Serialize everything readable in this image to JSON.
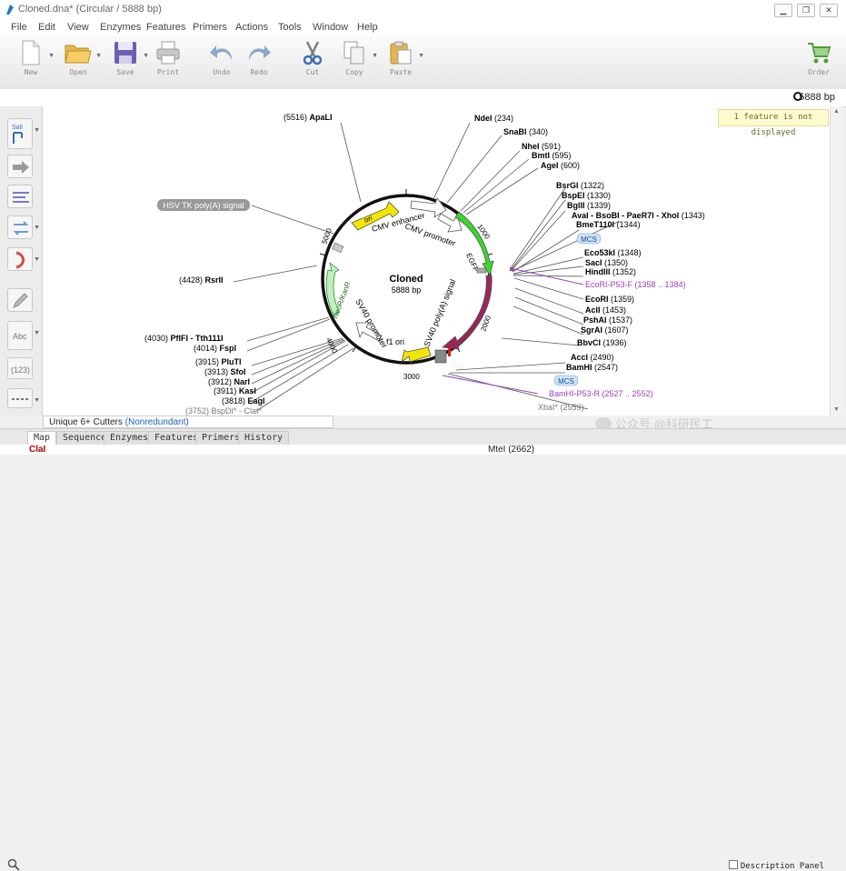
{
  "window": {
    "title": "Cloned.dna* (Circular / 5888 bp)"
  },
  "menu": [
    "File",
    "Edit",
    "View",
    "Enzymes",
    "Features",
    "Primers",
    "Actions",
    "Tools",
    "Window",
    "Help"
  ],
  "toolbar": [
    {
      "name": "new",
      "label": "New"
    },
    {
      "name": "open",
      "label": "Open"
    },
    {
      "name": "save",
      "label": "Save"
    },
    {
      "name": "print",
      "label": "Print"
    },
    {
      "name": "undo",
      "label": "Undo"
    },
    {
      "name": "redo",
      "label": "Redo"
    },
    {
      "name": "cut",
      "label": "Cut"
    },
    {
      "name": "copy",
      "label": "Copy"
    },
    {
      "name": "paste",
      "label": "Paste"
    },
    {
      "name": "order",
      "label": "Order"
    }
  ],
  "info": {
    "length": "5888 bp",
    "notice": "1 feature is not displayed"
  },
  "sidebar": {
    "saveicon": "SalI",
    "abc": "Abc",
    "count": "(123)"
  },
  "map": {
    "name": "Cloned",
    "length": "5888 bp",
    "ticks": [
      "1000",
      "2000",
      "3000",
      "4000",
      "5000"
    ],
    "features": [
      "ori",
      "CMV enhancer",
      "CMV promoter",
      "EGFP",
      "p53",
      "SV40 poly(A) signal",
      "f1 ori",
      "SV40 promoter",
      "NeoR/KanR"
    ],
    "hsv": "HSV TK poly(A) signal",
    "mcs": "MCS",
    "sites": [
      {
        "name": "ApaLI",
        "pos": "(5516)"
      },
      {
        "name": "NdeI",
        "pos": "(234)"
      },
      {
        "name": "SnaBI",
        "pos": "(340)"
      },
      {
        "name": "NheI",
        "pos": "(591)"
      },
      {
        "name": "BmtI",
        "pos": "(595)"
      },
      {
        "name": "AgeI",
        "pos": "(600)"
      },
      {
        "name": "BsrGI",
        "pos": "(1322)"
      },
      {
        "name": "BspEI",
        "pos": "(1330)"
      },
      {
        "name": "BglII",
        "pos": "(1339)"
      },
      {
        "name": "AvaI - BsoBI - PaeR7I - XhoI",
        "pos": "(1343)"
      },
      {
        "name": "BmeT110I",
        "pos": "(1344)"
      },
      {
        "name": "Eco53kI",
        "pos": "(1348)"
      },
      {
        "name": "SacI",
        "pos": "(1350)"
      },
      {
        "name": "HindIII",
        "pos": "(1352)"
      },
      {
        "name": "EcoRI",
        "pos": "(1359)"
      },
      {
        "name": "AclI",
        "pos": "(1453)"
      },
      {
        "name": "PshAI",
        "pos": "(1537)"
      },
      {
        "name": "SgrAI",
        "pos": "(1607)"
      },
      {
        "name": "BbvCI",
        "pos": "(1936)"
      },
      {
        "name": "AccI",
        "pos": "(2490)"
      },
      {
        "name": "BamHI",
        "pos": "(2547)"
      },
      {
        "name": "XbaI*",
        "pos": "(2559)"
      },
      {
        "name": "RsrII",
        "pos": "(4428)"
      },
      {
        "name": "PflFI - Tth111I",
        "pos": "(4030)"
      },
      {
        "name": "FspI",
        "pos": "(4014)"
      },
      {
        "name": "PluTI",
        "pos": "(3915)"
      },
      {
        "name": "SfoI",
        "pos": "(3913)"
      },
      {
        "name": "NarI",
        "pos": "(3912)"
      },
      {
        "name": "KasI",
        "pos": "(3911)"
      },
      {
        "name": "EagI",
        "pos": "(3818)"
      },
      {
        "name": "BspDI* - ClaI*",
        "pos": "(3752)"
      }
    ],
    "primers": [
      {
        "name": "EcoRI-P53-F",
        "range": "(1358 .. 1384)"
      },
      {
        "name": "BamHI-P53-R",
        "range": "(2527 .. 2552)"
      }
    ]
  },
  "cutters": {
    "label": "Unique 6+ Cutters",
    "mode": "(Nonredundant)"
  },
  "tabs": [
    "Map",
    "Sequence",
    "Enzymes",
    "Features",
    "Primers",
    "History"
  ],
  "description_panel": "Description Panel",
  "bottom": {
    "left": "ClaI",
    "right": "MteI (2662)"
  },
  "watermark": "公众号 @科研民工",
  "colors": {
    "ori": "#f3e600",
    "egfp": "#3bd62a",
    "p53": "#9b2559",
    "neo": "#bdf0bd",
    "primer": "#9b3ebf",
    "mcs": "#cfe3f6"
  }
}
